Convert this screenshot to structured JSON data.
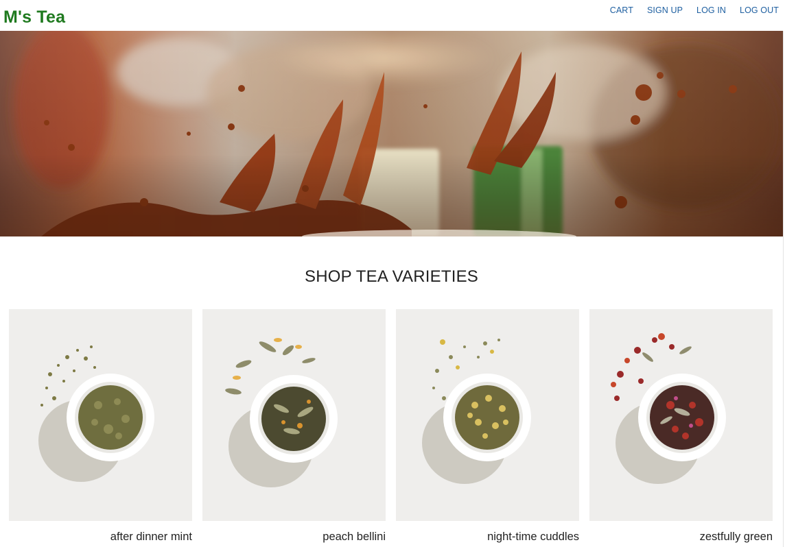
{
  "brand": {
    "logo": "M's Tea",
    "color": "#1f7a1f"
  },
  "nav": {
    "cart": "CART",
    "signup": "SIGN UP",
    "login": "LOG IN",
    "logout": "LOG OUT"
  },
  "hero": {
    "image": "tea-splash-photo"
  },
  "section": {
    "title": "SHOP TEA VARIETIES"
  },
  "products": [
    {
      "name": "after dinner mint",
      "image": "mint-tea-bowl-photo"
    },
    {
      "name": "peach bellini",
      "image": "peach-tea-bowl-photo"
    },
    {
      "name": "night-time cuddles",
      "image": "chamomile-tea-bowl-photo"
    },
    {
      "name": "zestfully green",
      "image": "berry-tea-bowl-photo"
    }
  ]
}
